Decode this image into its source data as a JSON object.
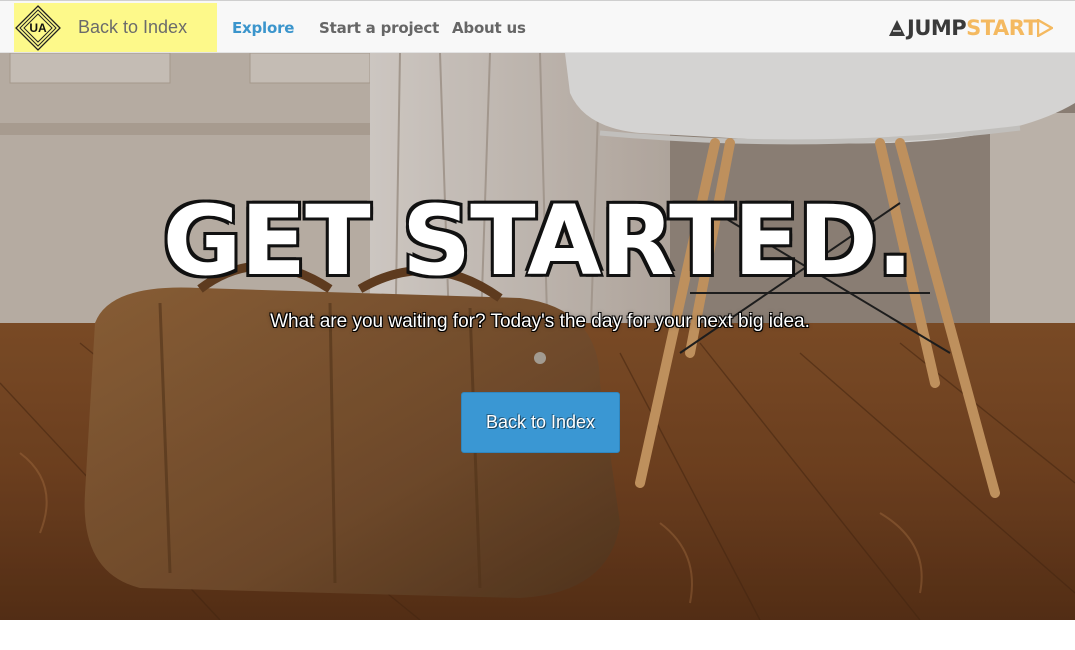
{
  "header": {
    "logo_text": "UA",
    "back_label": "Back to Index",
    "nav": [
      {
        "label": "Explore",
        "active": true
      },
      {
        "label": "Start a project",
        "active": false
      },
      {
        "label": "About us",
        "active": false
      }
    ],
    "brand": {
      "part1": "JUMP",
      "part2": "START"
    }
  },
  "hero": {
    "title": "GET STARTED.",
    "subtitle": "What are you waiting for? Today's the day for your next big idea.",
    "button_label": "Back to Index"
  },
  "colors": {
    "accent_blue": "#3a97d3",
    "back_tab_yellow": "#fdf98a",
    "brand_orange": "#f4b960",
    "brand_dark": "#3a3a3a"
  },
  "icons": {
    "logo": "ua-diamond-logo",
    "brand": "jumpstart-logo-arrows"
  }
}
